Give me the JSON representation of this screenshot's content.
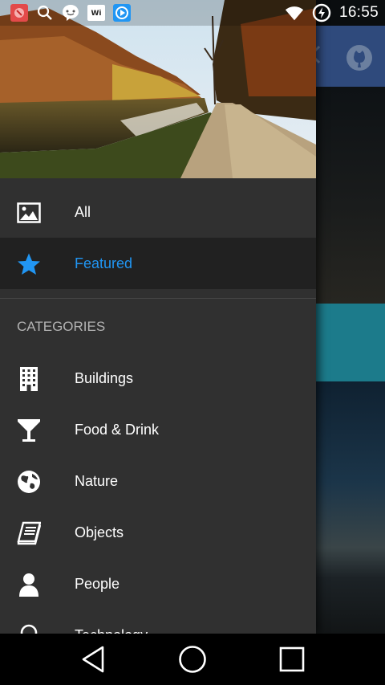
{
  "status_bar": {
    "time": "16:55",
    "left_icons": [
      "app-notification-icon",
      "search-icon",
      "messenger-icon",
      "wifi-signal-icon",
      "media-player-icon"
    ],
    "right_icons": [
      "wifi-icon",
      "battery-charging-icon"
    ]
  },
  "drawer": {
    "main_items": [
      {
        "label": "All",
        "icon": "image-icon",
        "active": false
      },
      {
        "label": "Featured",
        "icon": "star-icon",
        "active": true
      }
    ],
    "categories_header": "CATEGORIES",
    "categories": [
      {
        "label": "Buildings",
        "icon": "building-icon"
      },
      {
        "label": "Food & Drink",
        "icon": "cocktail-glass-icon"
      },
      {
        "label": "Nature",
        "icon": "globe-icon"
      },
      {
        "label": "Objects",
        "icon": "book-icon"
      },
      {
        "label": "People",
        "icon": "person-icon"
      },
      {
        "label": "Technology",
        "icon": "lightbulb-icon"
      }
    ]
  },
  "colors": {
    "drawer_bg": "#303030",
    "active_bg": "#212121",
    "accent": "#2196f3",
    "toolbar": "#2f4a7c",
    "teal_card": "#1c7b8b"
  },
  "nav_bar": {
    "buttons": [
      "back-icon",
      "home-icon",
      "recents-icon"
    ]
  }
}
